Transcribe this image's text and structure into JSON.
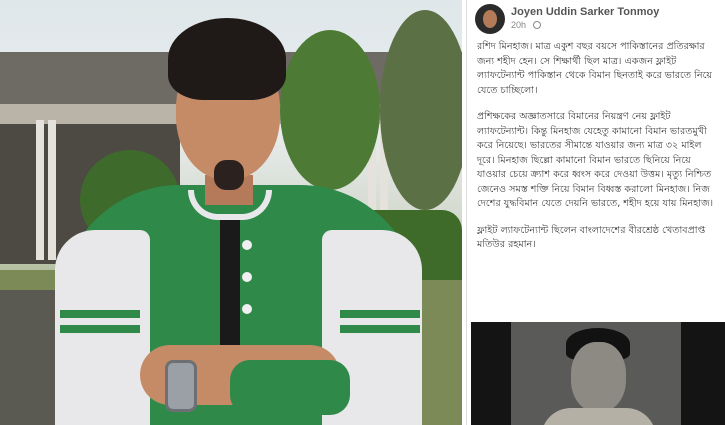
{
  "post": {
    "author": "Joyen Uddin Sarker Tonmoy",
    "time": "20h",
    "paragraphs": [
      "রশিদ মিনহাজ। মাত্র একুশ বছর বয়সে পাকিস্তানের প্রতিরক্ষার জন্য শহীদ হেন। সে শিক্ষার্থী ছিল মাত্র। একজন ফ্লাইট ল্যাফটেন্যান্ট পাকিস্তান থেকে বিমান ছিনতাই করে ভারতে নিয়ে যেতে চাচ্ছিলো।",
      "প্রশিক্ষকের অজ্ঞাতসারে বিমানের নিয়ন্ত্রণ নেয় ফ্লাইট ল্যাফটেন্যান্ট। কিন্তু মিনহাজ যেহেতু কামানো বিমান ভারতমুখী করে নিয়েছে। ভারতের সীমান্তে যাওয়ার জন্য মাত্র ৩২ মাইল দূরে। মিনহাজ ছিল্লো কামানো বিমান ভারতে ছিনিয়ে নিয়ে যাওয়ার চেয়ে ক্র্যাশ করে ধ্বংস করে দেওয়া উত্তম। মৃত্যু নিশ্চিত জেনেও সমস্ত শক্তি নিয়ে বিমান বিধ্বস্ত করালো মিনহাজ। নিজ দেশের যুদ্ধবিমান যেতে দেয়নি ভারতে, শহীদ হয়ে যায় মিনহাজ।",
      "ফ্লাইট ল্যাফটেন্যান্ট ছিলেন বাংলাদেশের বীরশ্রেষ্ঠ খেতাবপ্রাপ্ত মতিউর রহমান।"
    ]
  }
}
